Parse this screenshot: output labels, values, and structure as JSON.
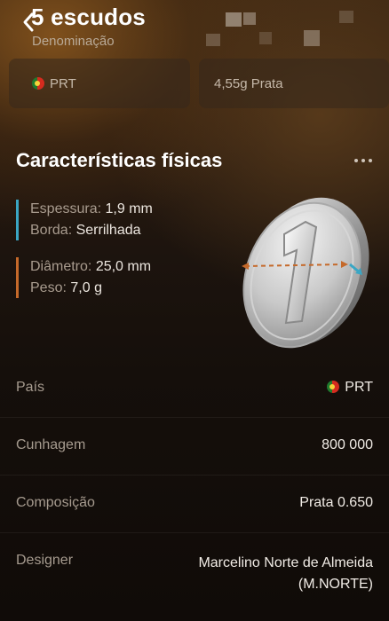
{
  "header": {
    "title": "5 escudos",
    "subtitle": "Denominação",
    "back_icon": "chevron-left-icon"
  },
  "cards": {
    "country_code": "PRT",
    "weight_metal": "4,55g Prata"
  },
  "physical": {
    "section_title": "Características físicas",
    "thickness_label": "Espessura:",
    "thickness_value": "1,9 mm",
    "edge_label": "Borda:",
    "edge_value": "Serrilhada",
    "diameter_label": "Diâmetro:",
    "diameter_value": "25,0 mm",
    "weight_label": "Peso:",
    "weight_value": "7,0 g",
    "colors": {
      "thickness_accent": "#3aa6c4",
      "diameter_accent": "#c5692a"
    }
  },
  "details": [
    {
      "label": "País",
      "value": "PRT"
    },
    {
      "label": "Cunhagem",
      "value": "800 000"
    },
    {
      "label": "Composição",
      "value": "Prata 0.650"
    },
    {
      "label": "Designer",
      "value": "Marcelino Norte de Almeida",
      "value2": "(M.NORTE)"
    }
  ]
}
